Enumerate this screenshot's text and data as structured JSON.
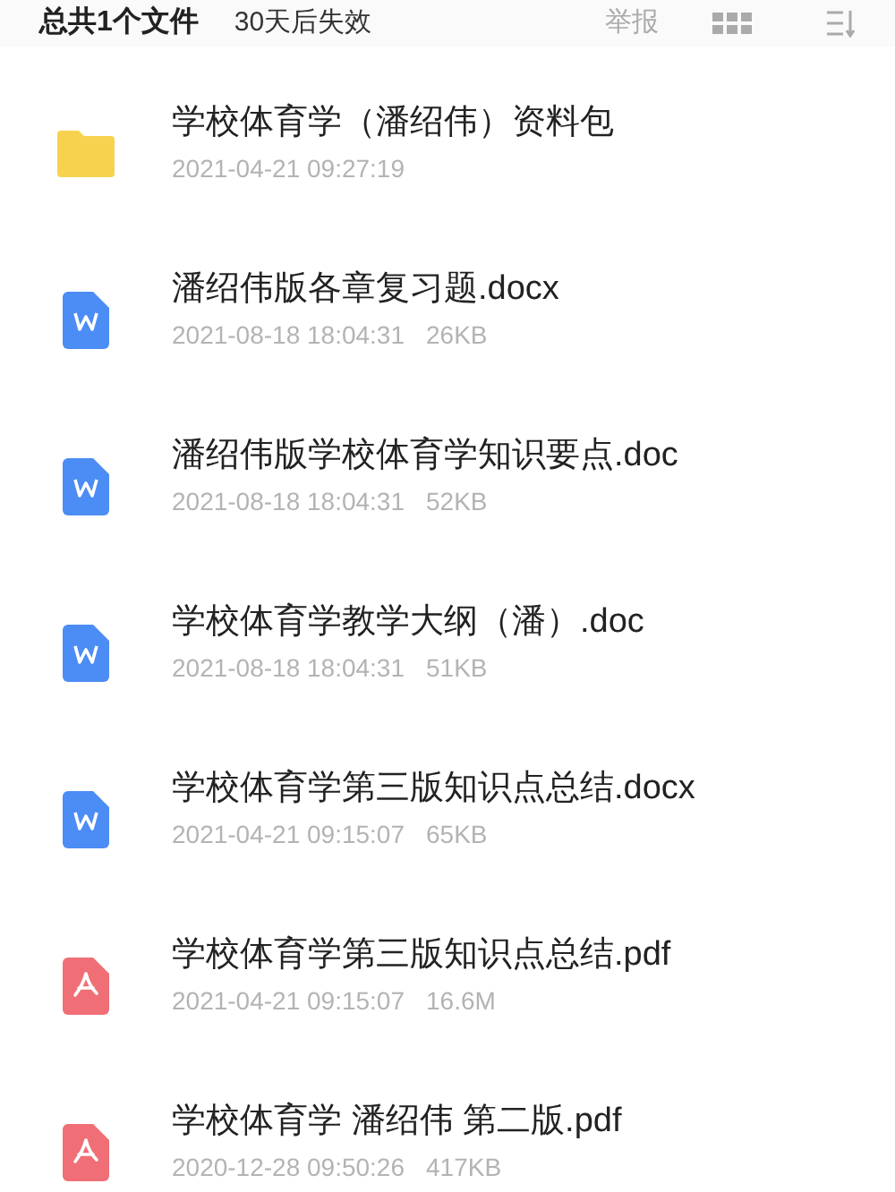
{
  "header": {
    "summary": "总共1个文件",
    "expiry": "30天后失效",
    "report": "举报"
  },
  "files": [
    {
      "kind": "folder",
      "name": "学校体育学（潘绍伟）资料包",
      "time": "2021-04-21 09:27:19"
    },
    {
      "kind": "word",
      "name": "潘绍伟版各章复习题.docx",
      "time": "2021-08-18 18:04:31",
      "size": "26KB"
    },
    {
      "kind": "word",
      "name": "潘绍伟版学校体育学知识要点.doc",
      "time": "2021-08-18 18:04:31",
      "size": "52KB"
    },
    {
      "kind": "word",
      "name": "学校体育学教学大纲（潘）.doc",
      "time": "2021-08-18 18:04:31",
      "size": "51KB"
    },
    {
      "kind": "word",
      "name": "学校体育学第三版知识点总结.docx",
      "time": "2021-04-21 09:15:07",
      "size": "65KB"
    },
    {
      "kind": "pdf",
      "name": "学校体育学第三版知识点总结.pdf",
      "time": "2021-04-21 09:15:07",
      "size": "16.6M"
    },
    {
      "kind": "pdf",
      "name": "学校体育学 潘绍伟 第二版.pdf",
      "time": "2020-12-28 09:50:26",
      "size": "417KB"
    }
  ]
}
